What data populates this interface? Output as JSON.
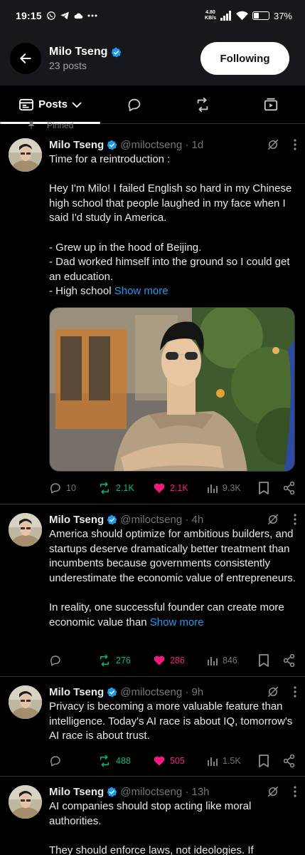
{
  "status_bar": {
    "time": "19:15",
    "net_speed_value": "4.80",
    "net_speed_unit": "KB/s",
    "battery": "37%",
    "battery_level": 0.37
  },
  "header": {
    "name": "Milo Tseng",
    "posts_count": "23 posts",
    "follow_button": "Following"
  },
  "tabs": {
    "active_label": "Posts"
  },
  "tweets": [
    {
      "pinned": "Pinned",
      "name": "Milo Tseng",
      "handle_time": "@miloctseng · 1d",
      "lines": [
        "Time for a reintroduction :",
        "",
        "Hey I'm Milo! I failed English so hard in my Chinese high school that people laughed in my face when I said I'd study in America.",
        "",
        "- Grew up in the hood of Beijing.",
        "- Dad worked himself into the ground so I could get an education.",
        "- High school"
      ],
      "show_more": "Show more",
      "replies": "10",
      "reposts": "2.1K",
      "likes": "2.1K",
      "views": "9.3K"
    },
    {
      "name": "Milo Tseng",
      "handle_time": "@miloctseng · 4h",
      "lines": [
        "America should optimize for ambitious builders, and startups deserve dramatically better treatment than incumbents because governments consistently underestimate the economic value of entrepreneurs.",
        "",
        "In reality, one successful founder can create more economic value than"
      ],
      "show_more": "Show more",
      "replies": "",
      "reposts": "276",
      "likes": "286",
      "views": "846"
    },
    {
      "name": "Milo Tseng",
      "handle_time": "@miloctseng · 9h",
      "lines": [
        "Privacy is becoming a more valuable feature than intelligence. Today's AI race is about IQ, tomorrow's AI race is about trust."
      ],
      "replies": "",
      "reposts": "488",
      "likes": "505",
      "views": "1.5K"
    },
    {
      "name": "Milo Tseng",
      "handle_time": "@miloctseng · 13h",
      "lines": [
        "AI companies should stop acting like moral authorities.",
        "",
        "They should enforce laws, not ideologies. If"
      ]
    }
  ],
  "colors": {
    "accent": "#1d9bf0",
    "verified": "#1d9bf0",
    "repost": "#00ba7c",
    "like": "#f91880",
    "muted": "#71767b"
  },
  "icons": [
    "back-arrow-icon",
    "verified-badge-icon",
    "posts-tab-icon",
    "chevron-down-icon",
    "replies-tab-icon",
    "reposts-tab-icon",
    "media-tab-icon",
    "pin-icon",
    "grok-icon",
    "more-icon",
    "reply-icon",
    "repost-icon",
    "heart-icon",
    "views-icon",
    "bookmark-icon",
    "share-icon"
  ]
}
